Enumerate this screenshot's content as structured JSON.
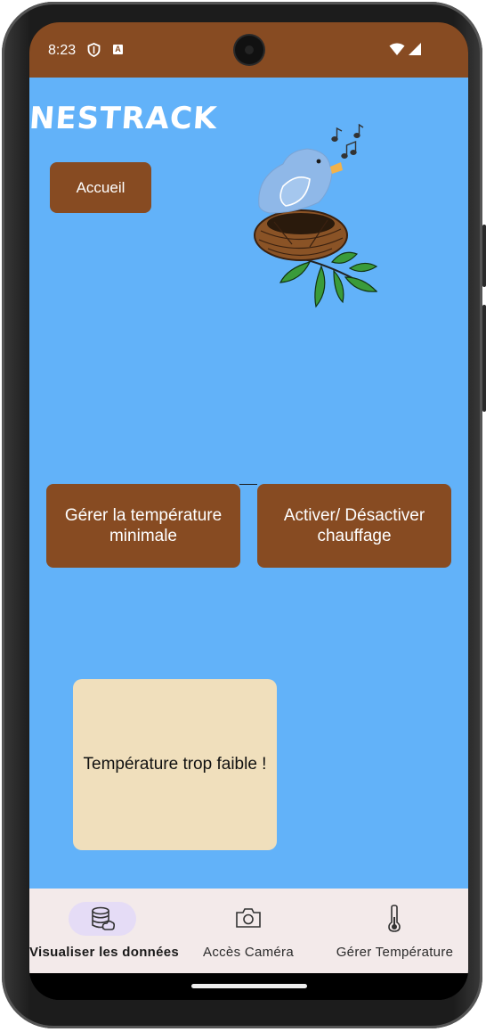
{
  "status_bar": {
    "time": "8:23",
    "icons": [
      "shield-icon",
      "a-key-icon",
      "wifi-icon",
      "signal-icon"
    ]
  },
  "app": {
    "logo_text": "NESTRACK",
    "home_button": "Accueil",
    "temp_button": "Gérer la température minimale",
    "heat_button": "Activer/ Désactiver chauffage",
    "alert_message": "Température trop faible !",
    "illustration": "bird-in-nest-icon"
  },
  "bottom_nav": {
    "items": [
      {
        "label": "Visualiser les données",
        "icon": "database-icon",
        "active": true
      },
      {
        "label": "Accès Caméra",
        "icon": "camera-icon",
        "active": false
      },
      {
        "label": "Gérer Température",
        "icon": "thermometer-icon",
        "active": false
      }
    ]
  },
  "colors": {
    "brand_brown": "#874b22",
    "background_blue": "#62b2f9",
    "alert_beige": "#f0dfbc",
    "nav_background": "#f3eaea",
    "nav_active_pill": "#e5dcf6"
  }
}
